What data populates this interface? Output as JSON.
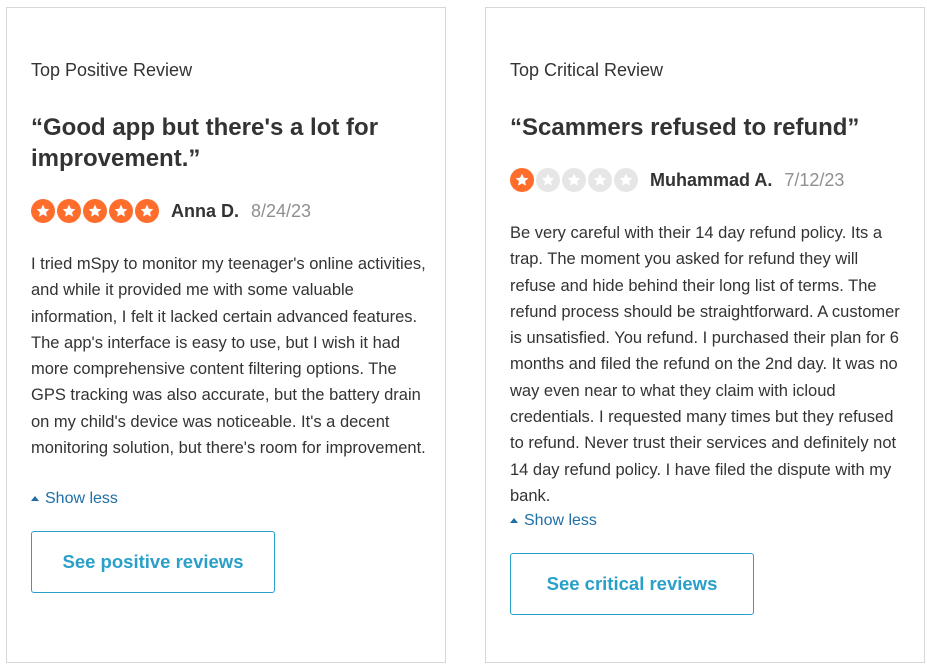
{
  "positive": {
    "label": "Top Positive Review",
    "title": "“Good app but there's a lot for improvement.”",
    "rating": 5,
    "reviewer": "Anna D.",
    "date": "8/24/23",
    "body": "I tried mSpy to monitor my teenager's online activities, and while it provided me with some valuable information, I felt it lacked certain advanced features. The app's interface is easy to use, but I wish it had more comprehensive content filtering options. The GPS tracking was also accurate, but the battery drain on my child's device was noticeable. It's a decent monitoring solution, but there's room for improvement.",
    "show_less": "Show less",
    "button": "See positive reviews"
  },
  "critical": {
    "label": "Top Critical Review",
    "title": "“Scammers refused to refund”",
    "rating": 1,
    "reviewer": "Muhammad A.",
    "date": "7/12/23",
    "body": "Be very careful with their 14 day refund policy. Its a trap. The moment you asked for refund they will refuse and hide behind their long list of terms. The refund process should be straightforward. A customer is unsatisfied. You refund. I purchased their plan for 6 months and filed the refund on the 2nd day. It was no way even near to what they claim with icloud credentials. I requested many times but they refused to refund. Never trust their services and definitely not 14 day refund policy. I have filed the dispute with my bank.",
    "show_less": "Show less",
    "button": "See critical reviews"
  },
  "colors": {
    "star_filled": "#ff6d2c",
    "star_empty": "#e6e6e6",
    "link": "#1e6fa6",
    "button_accent": "#2a9fc9"
  }
}
